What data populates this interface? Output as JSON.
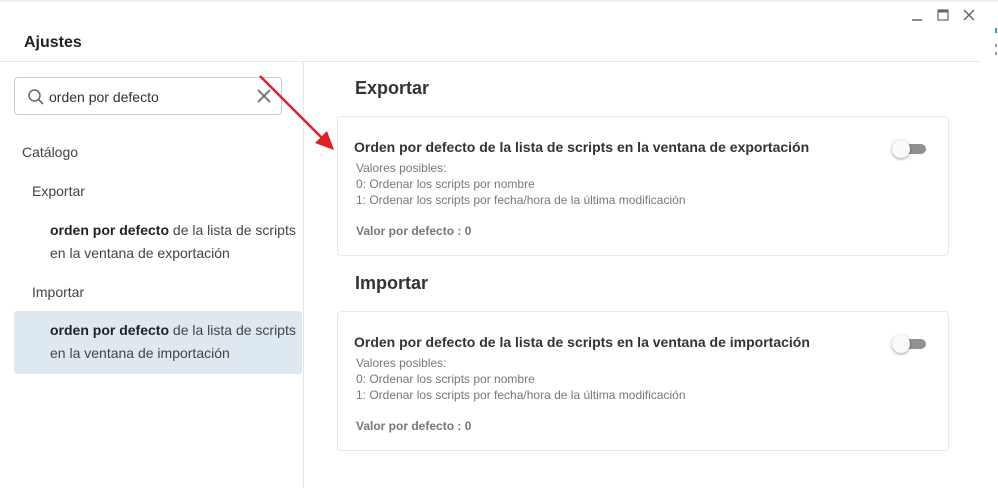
{
  "window": {
    "title": "Ajustes",
    "controls": [
      "minimize-icon",
      "maximize-icon",
      "close-icon"
    ]
  },
  "search": {
    "value": "orden por defecto",
    "icon": "search-icon",
    "clear_icon": "clear-icon"
  },
  "tree": {
    "root": "Catálogo",
    "groups": [
      {
        "label": "Exportar",
        "leaf": {
          "match": "orden por defecto",
          "rest_line1": " de la lista de scripts",
          "line2": "en la ventana de exportación"
        }
      },
      {
        "label": "Importar",
        "leaf": {
          "match": "orden por defecto",
          "rest_line1": " de la lista de scripts",
          "line2": "en la ventana de importación"
        }
      }
    ]
  },
  "sections": [
    {
      "title": "Exportar",
      "card": {
        "title": "Orden por defecto de la lista de scripts en la ventana de exportación",
        "desc": [
          "Valores posibles:",
          "0: Ordenar los scripts por nombre",
          "1: Ordenar los scripts por fecha/hora de la última modificación"
        ],
        "default_label": "Valor por defecto :",
        "default_value": "0",
        "toggle_on": false
      }
    },
    {
      "title": "Importar",
      "card": {
        "title": "Orden por defecto de la lista de scripts en la ventana de importación",
        "desc": [
          "Valores posibles:",
          "0: Ordenar los scripts por nombre",
          "1: Ordenar los scripts por fecha/hora de la última modificación"
        ],
        "default_label": "Valor por defecto :",
        "default_value": "0",
        "toggle_on": false
      }
    }
  ],
  "colors": {
    "annotation_arrow": "#e02020",
    "selected_bg": "#dde8f1",
    "toggle_track": "#8e9295"
  }
}
